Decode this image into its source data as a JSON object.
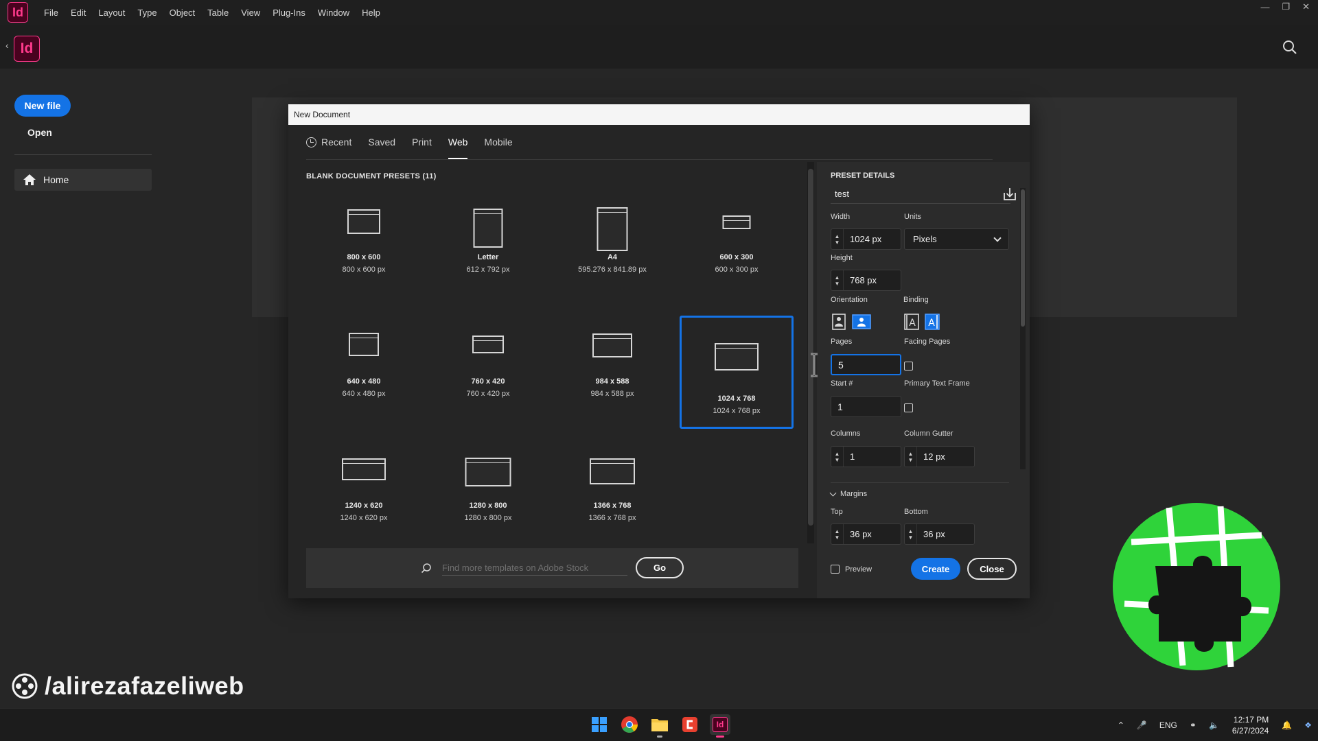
{
  "app": {
    "logo_text": "Id",
    "menus": [
      "File",
      "Edit",
      "Layout",
      "Type",
      "Object",
      "Table",
      "View",
      "Plug-Ins",
      "Window",
      "Help"
    ],
    "window_controls": [
      "minimize-icon",
      "restore-icon",
      "close-icon"
    ],
    "accent": "#1473e6",
    "brand": "#ff3a8c"
  },
  "home": {
    "logo_text": "Id",
    "new_file_label": "New file",
    "open_label": "Open",
    "home_label": "Home"
  },
  "dialog": {
    "title": "New Document",
    "tabs": [
      {
        "label": "Recent",
        "active": false
      },
      {
        "label": "Saved",
        "active": false
      },
      {
        "label": "Print",
        "active": false
      },
      {
        "label": "Web",
        "active": true
      },
      {
        "label": "Mobile",
        "active": false
      }
    ],
    "presets_title": "BLANK DOCUMENT PRESETS  (11)",
    "presets": [
      {
        "name": "800 x 600",
        "dims": "800 x 600 px",
        "selected": false
      },
      {
        "name": "Letter",
        "dims": "612 x 792 px",
        "selected": false
      },
      {
        "name": "A4",
        "dims": "595.276 x 841.89 px",
        "selected": false
      },
      {
        "name": "600 x 300",
        "dims": "600 x 300 px",
        "selected": false
      },
      {
        "name": "640 x 480",
        "dims": "640 x 480 px",
        "selected": false
      },
      {
        "name": "760 x 420",
        "dims": "760 x 420 px",
        "selected": false
      },
      {
        "name": "984 x 588",
        "dims": "984 x 588 px",
        "selected": false
      },
      {
        "name": "1024 x 768",
        "dims": "1024 x 768 px",
        "selected": true
      },
      {
        "name": "1240 x 620",
        "dims": "1240 x 620 px",
        "selected": false
      },
      {
        "name": "1280 x 800",
        "dims": "1280 x 800 px",
        "selected": false
      },
      {
        "name": "1366 x 768",
        "dims": "1366 x 768 px",
        "selected": false
      }
    ],
    "stock_placeholder": "Find more templates on Adobe Stock",
    "go_label": "Go",
    "details": {
      "heading": "PRESET DETAILS",
      "preset_name": "test",
      "width_label": "Width",
      "width_value": "1024 px",
      "units_label": "Units",
      "units_value": "Pixels",
      "height_label": "Height",
      "height_value": "768 px",
      "orientation_label": "Orientation",
      "binding_label": "Binding",
      "pages_label": "Pages",
      "pages_value": "5",
      "facing_pages_label": "Facing Pages",
      "facing_pages_checked": false,
      "start_label": "Start #",
      "start_value": "1",
      "primary_frame_label": "Primary Text Frame",
      "primary_frame_checked": false,
      "columns_label": "Columns",
      "columns_value": "1",
      "gutter_label": "Column Gutter",
      "gutter_value": "12 px",
      "margins_label": "Margins",
      "top_label": "Top",
      "top_value": "36 px",
      "bottom_label": "Bottom",
      "bottom_value": "36 px",
      "preview_label": "Preview",
      "create_label": "Create",
      "close_label": "Close"
    }
  },
  "watermark": {
    "handle": "/alirezafazeliweb"
  },
  "taskbar": {
    "apps": [
      "windows-start-icon",
      "chrome-icon",
      "file-explorer-icon",
      "clipchamp-icon",
      "indesign-icon"
    ],
    "indesign_text": "Id",
    "language": "ENG",
    "time": "12:17 PM",
    "date": "6/27/2024"
  }
}
